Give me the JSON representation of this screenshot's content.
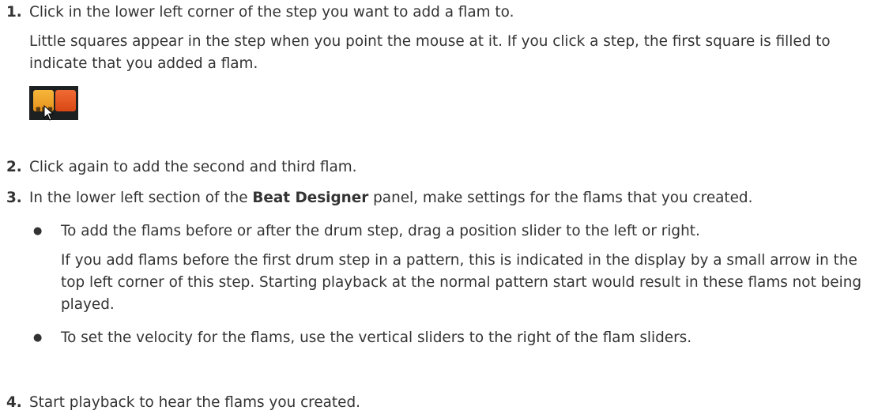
{
  "steps": [
    {
      "number": "1.",
      "text": "Click in the lower left corner of the step you want to add a flam to.",
      "detail": "Little squares appear in the step when you point the mouse at it. If you click a step, the first square is filled to indicate that you added a flam."
    },
    {
      "number": "2.",
      "text": "Click again to add the second and third flam."
    },
    {
      "number": "3.",
      "text_before": "In the lower left section of the ",
      "text_bold": "Beat Designer",
      "text_after": " panel, make settings for the flams that you created.",
      "bullets": [
        {
          "text": "To add the flams before or after the drum step, drag a position slider to the left or right.",
          "detail": "If you add flams before the first drum step in a pattern, this is indicated in the display by a small arrow in the top left corner of this step. Starting playback at the normal pattern start would result in these flams not being played."
        },
        {
          "text": "To set the velocity for the flams, use the vertical sliders to the right of the flam sliders."
        }
      ]
    },
    {
      "number": "4.",
      "text": "Start playback to hear the flams you created."
    }
  ],
  "icons": {
    "step_pads": "drum-step-pads-with-cursor-icon",
    "pad_colors": [
      "#f2a62a",
      "#e45a22"
    ],
    "background": "#1d2021"
  }
}
